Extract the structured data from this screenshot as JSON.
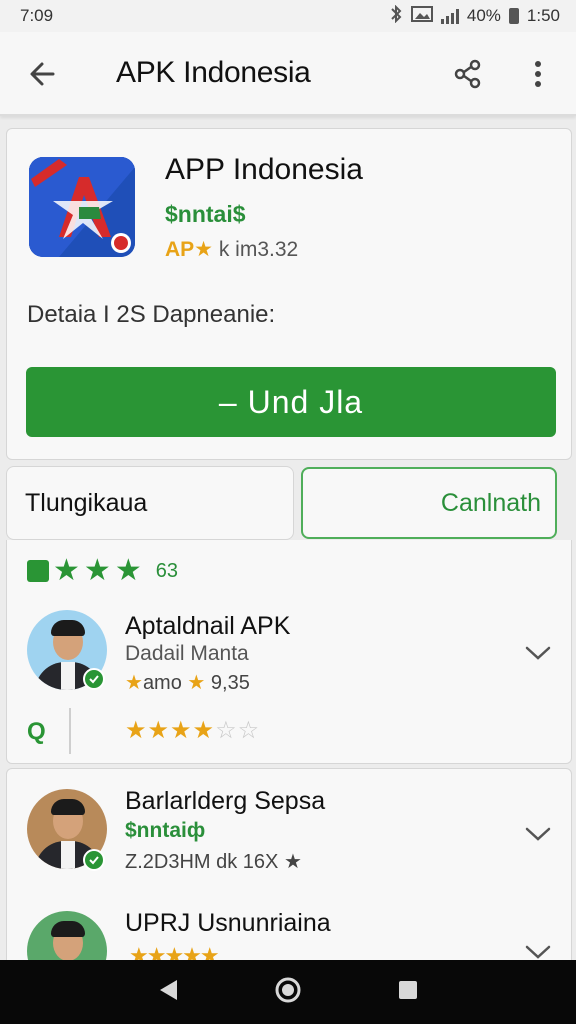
{
  "status_bar": {
    "time": "7:09",
    "signal": ".ıll",
    "battery_pct": "40%",
    "clock": "1:50"
  },
  "app_bar": {
    "title": "APK Indonesia",
    "back_icon": "arrow-left-icon",
    "share_icon": "share-icon",
    "more_icon": "more-vert-icon"
  },
  "app": {
    "name": "APP Indonesia",
    "price": "$nntai$",
    "rating_prefix": "AP★",
    "rating_suffix": "k im3.32",
    "details": "Detaia I 2S Dapneanie:",
    "install_label": "– Und Jla"
  },
  "tabs": [
    {
      "label": "Tlungikaua"
    },
    {
      "label": "Canlnath"
    }
  ],
  "reviews": {
    "summary_count": "63",
    "summary_stars": 3,
    "items": [
      {
        "name": "Aptaldnail APK",
        "subtitle": "Dadail Manta",
        "meta_stars_a": "★",
        "meta_text": "amo",
        "meta_stars_b": "★",
        "meta_value": "9,35"
      },
      {
        "name": "Barlarlderg Sepsa",
        "price": "$nntaiф",
        "meta": "Z.2D3HМ dk 16X ★"
      },
      {
        "name": "UPRJ Usnunriaina"
      }
    ],
    "row_letter": "Q",
    "row_stars_filled": 4,
    "row_stars_total": 6
  },
  "colors": {
    "accent_green": "#2a9535",
    "star_gold": "#e8a317",
    "icon_blue": "#1f4fb8"
  }
}
